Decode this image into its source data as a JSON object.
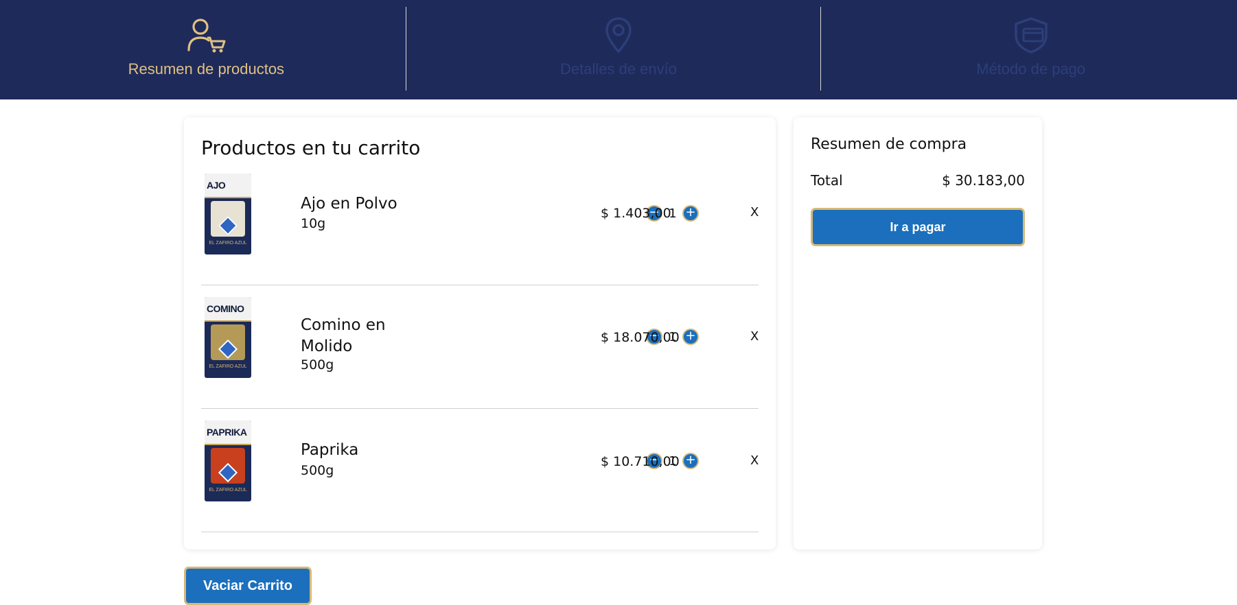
{
  "steps": [
    {
      "label": "Resumen de productos",
      "icon": "user-cart-icon",
      "state": "active"
    },
    {
      "label": "Detalles de envío",
      "icon": "location-pin-icon",
      "state": "inactive"
    },
    {
      "label": "Método de pago",
      "icon": "payment-shield-icon",
      "state": "inactive"
    }
  ],
  "colors": {
    "header_bg": "#1e2a5a",
    "active_gold": "#e0c182",
    "inactive_blue": "#2c3f7a",
    "button_blue": "#1b6fbd",
    "button_border": "#d8b875"
  },
  "cart": {
    "title": "Productos en tu carrito",
    "items": [
      {
        "name": "Ajo en Polvo",
        "weight": "10g",
        "quantity": "1",
        "price": "$ 1.403,00",
        "remove": "X",
        "package_label": "AJO",
        "package_color": "#e8e2d2"
      },
      {
        "name": "Comino en Molido",
        "weight": "500g",
        "quantity": "1",
        "price": "$ 18.070,00",
        "remove": "X",
        "package_label": "COMINO",
        "package_color": "#b59a57"
      },
      {
        "name": "Paprika",
        "weight": "500g",
        "quantity": "1",
        "price": "$ 10.710,00",
        "remove": "X",
        "package_label": "PAPRIKA",
        "package_color": "#c8401e"
      }
    ],
    "empty_button": "Vaciar Carrito"
  },
  "summary": {
    "title": "Resumen de compra",
    "total_label": "Total",
    "total_value": "$ 30.183,00",
    "pay_button": "Ir a pagar"
  }
}
